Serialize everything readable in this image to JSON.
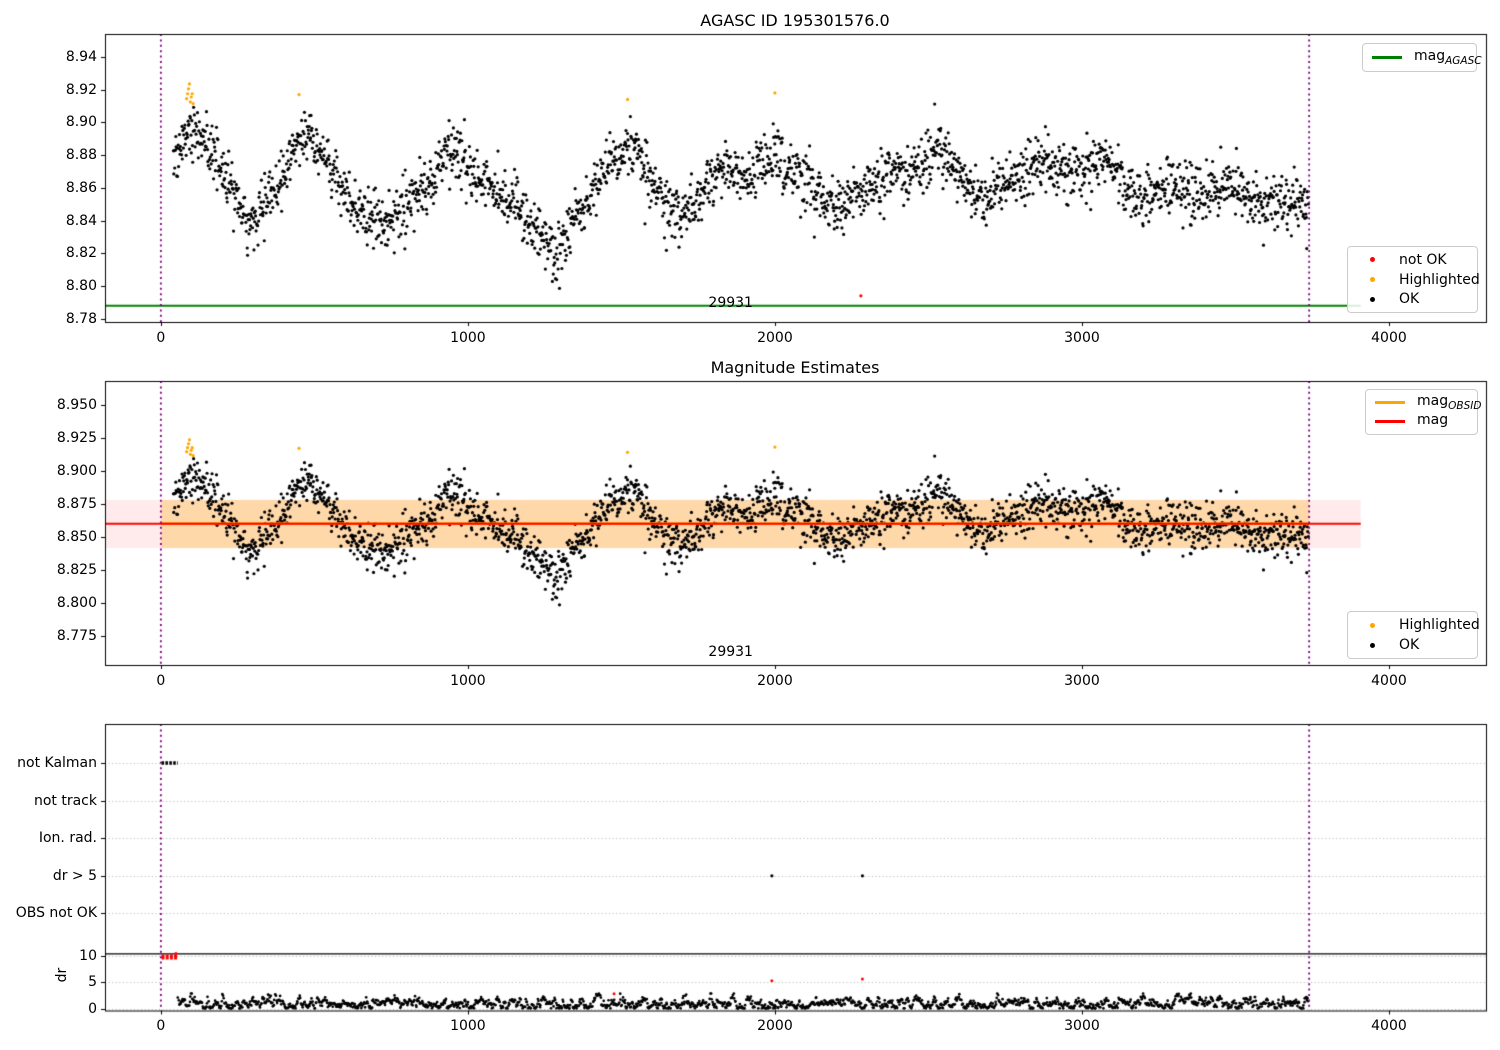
{
  "colors": {
    "ok": "#000000",
    "not_ok": "#ff0000",
    "highlighted": "#ffa500",
    "mag_agasc_line": "#008000",
    "mag_line": "#ff0000",
    "obsid_line": "#ffa500",
    "vline": "#800080",
    "band_pink": "rgba(255,0,0,0.08)",
    "band_orange": "rgba(255,165,0,0.28)",
    "grid": "#b4b4b4",
    "separator": "#000000"
  },
  "chart_data": [
    {
      "type": "scatter",
      "title": "AGASC ID 195301576.0",
      "xlim": [
        -182,
        4316
      ],
      "ylim": [
        8.778,
        8.954
      ],
      "grid": false,
      "xticks": [
        {
          "v": 0,
          "label": "0"
        },
        {
          "v": 1000,
          "label": "1000"
        },
        {
          "v": 2000,
          "label": "2000"
        },
        {
          "v": 3000,
          "label": "3000"
        },
        {
          "v": 4000,
          "label": "4000"
        }
      ],
      "yticks": [
        {
          "v": 8.78,
          "label": "8.78"
        },
        {
          "v": 8.8,
          "label": "8.80"
        },
        {
          "v": 8.82,
          "label": "8.82"
        },
        {
          "v": 8.84,
          "label": "8.84"
        },
        {
          "v": 8.86,
          "label": "8.86"
        },
        {
          "v": 8.88,
          "label": "8.88"
        },
        {
          "v": 8.9,
          "label": "8.90"
        },
        {
          "v": 8.92,
          "label": "8.92"
        },
        {
          "v": 8.94,
          "label": "8.94"
        }
      ],
      "hline": {
        "y": 8.788,
        "x0": -182,
        "x1": 3908
      },
      "vlines": [
        0,
        3740
      ],
      "annotation": {
        "text": "29931",
        "x": 1856,
        "y": 8.7865
      },
      "legend_line": {
        "label_main": "mag",
        "label_sub": "AGASC",
        "position": "upper right"
      },
      "legend_markers": {
        "position": "lower right",
        "entries": [
          {
            "label": "not OK",
            "color_key": "not_ok"
          },
          {
            "label": "Highlighted",
            "color_key": "highlighted"
          },
          {
            "label": "OK",
            "color_key": "ok"
          }
        ]
      },
      "scatter_model": {
        "n": 2400,
        "x_start": 40,
        "x_end": 3738,
        "sigma": 0.0082,
        "seed": 42,
        "dip_prob": 0.05,
        "dip_max": 0.018,
        "mean_x": [
          40,
          70,
          100,
          130,
          170,
          210,
          250,
          290,
          330,
          370,
          410,
          450,
          480,
          520,
          560,
          610,
          660,
          720,
          780,
          840,
          900,
          950,
          990,
          1040,
          1090,
          1140,
          1190,
          1240,
          1290,
          1340,
          1390,
          1440,
          1490,
          1540,
          1590,
          1640,
          1690,
          1740,
          1790,
          1840,
          1890,
          1940,
          1990,
          2040,
          2090,
          2140,
          2190,
          2240,
          2290,
          2340,
          2390,
          2440,
          2490,
          2540,
          2590,
          2640,
          2690,
          2740,
          2790,
          2840,
          2890,
          2940,
          2990,
          3040,
          3090,
          3140,
          3190,
          3240,
          3290,
          3340,
          3390,
          3440,
          3490,
          3540,
          3590,
          3640,
          3690,
          3738
        ],
        "mean_y": [
          8.876,
          8.888,
          8.898,
          8.891,
          8.882,
          8.866,
          8.848,
          8.84,
          8.85,
          8.862,
          8.876,
          8.888,
          8.894,
          8.883,
          8.87,
          8.852,
          8.844,
          8.838,
          8.846,
          8.856,
          8.872,
          8.886,
          8.877,
          8.866,
          8.86,
          8.853,
          8.842,
          8.828,
          8.822,
          8.836,
          8.854,
          8.868,
          8.88,
          8.886,
          8.868,
          8.852,
          8.843,
          8.85,
          8.864,
          8.876,
          8.868,
          8.872,
          8.88,
          8.87,
          8.867,
          8.857,
          8.848,
          8.853,
          8.861,
          8.866,
          8.867,
          8.87,
          8.877,
          8.884,
          8.872,
          8.86,
          8.854,
          8.861,
          8.867,
          8.872,
          8.877,
          8.869,
          8.871,
          8.877,
          8.878,
          8.862,
          8.853,
          8.857,
          8.863,
          8.859,
          8.854,
          8.86,
          8.862,
          8.855,
          8.85,
          8.852,
          8.853,
          8.849
        ]
      },
      "highlighted_points": [
        [
          84,
          8.9145
        ],
        [
          87,
          8.9175
        ],
        [
          90,
          8.9205
        ],
        [
          93,
          8.9235
        ],
        [
          96,
          8.9125
        ],
        [
          99,
          8.9155
        ],
        [
          102,
          8.9175
        ],
        [
          105,
          8.9115
        ],
        [
          450,
          8.917
        ],
        [
          1520,
          8.914
        ],
        [
          2000,
          8.918
        ]
      ],
      "not_ok_points": [
        [
          2280,
          8.794
        ]
      ]
    },
    {
      "type": "scatter",
      "title": "Magnitude Estimates",
      "xlim": [
        -182,
        4316
      ],
      "ylim": [
        8.753,
        8.968
      ],
      "grid": false,
      "xticks": [
        {
          "v": 0,
          "label": "0"
        },
        {
          "v": 1000,
          "label": "1000"
        },
        {
          "v": 2000,
          "label": "2000"
        },
        {
          "v": 3000,
          "label": "3000"
        },
        {
          "v": 4000,
          "label": "4000"
        }
      ],
      "yticks": [
        {
          "v": 8.775,
          "label": "8.775"
        },
        {
          "v": 8.8,
          "label": "8.800"
        },
        {
          "v": 8.825,
          "label": "8.825"
        },
        {
          "v": 8.85,
          "label": "8.850"
        },
        {
          "v": 8.875,
          "label": "8.875"
        },
        {
          "v": 8.9,
          "label": "8.900"
        },
        {
          "v": 8.925,
          "label": "8.925"
        },
        {
          "v": 8.95,
          "label": "8.950"
        }
      ],
      "band": {
        "y0": 8.8415,
        "y1": 8.878,
        "x0": -182,
        "x1": 3908,
        "color_key": "band_pink"
      },
      "band_obsid": {
        "y0": 8.8415,
        "y1": 8.878,
        "x0": 0,
        "x1": 3740,
        "color_key": "band_orange"
      },
      "mag_line": {
        "y": 8.86,
        "x0": -182,
        "x1": 3908
      },
      "obsid_line": {
        "y": 8.86,
        "x0": 0,
        "x1": 3740
      },
      "vlines": [
        0,
        3740
      ],
      "annotation": {
        "text": "29931",
        "x": 1856,
        "y": 8.759
      },
      "legend_lines": {
        "position": "upper right",
        "entries": [
          {
            "label_main": "mag",
            "label_sub": "OBSID",
            "color_key": "obsid_line"
          },
          {
            "label_main": "mag",
            "label_sub": "",
            "color_key": "mag_line"
          }
        ]
      },
      "legend_markers": {
        "position": "lower right",
        "entries": [
          {
            "label": "Highlighted",
            "color_key": "highlighted"
          },
          {
            "label": "OK",
            "color_key": "ok"
          }
        ]
      },
      "uses_scatter_of": 0,
      "highlighted_points": [
        [
          84,
          8.9145
        ],
        [
          87,
          8.9175
        ],
        [
          90,
          8.9205
        ],
        [
          93,
          8.9235
        ],
        [
          96,
          8.9125
        ],
        [
          99,
          8.9155
        ],
        [
          102,
          8.9175
        ],
        [
          105,
          8.9115
        ],
        [
          450,
          8.917
        ],
        [
          1520,
          8.914
        ],
        [
          2000,
          8.918
        ]
      ]
    },
    {
      "type": "flags",
      "rows": [
        {
          "label": "not Kalman"
        },
        {
          "label": "not track"
        },
        {
          "label": "Ion. rad."
        },
        {
          "label": "dr > 5"
        },
        {
          "label": "OBS not OK"
        }
      ],
      "dr_axis": {
        "label": "dr",
        "ticks": [
          {
            "v": 10,
            "label": "10"
          },
          {
            "v": 5,
            "label": "5"
          },
          {
            "v": 0,
            "label": "0"
          }
        ],
        "separator_dr": 10.3
      },
      "xlim": [
        -182,
        4316
      ],
      "xticks": [
        {
          "v": 0,
          "label": "0"
        },
        {
          "v": 1000,
          "label": "1000"
        },
        {
          "v": 2000,
          "label": "2000"
        },
        {
          "v": 3000,
          "label": "3000"
        },
        {
          "v": 4000,
          "label": "4000"
        }
      ],
      "grid": true,
      "vlines": [
        0,
        3740
      ],
      "flag_segments": [
        {
          "row": "not Kalman",
          "x0": 2,
          "x1": 55
        }
      ],
      "dr_clipped_segment": {
        "x0": 2,
        "x1": 55,
        "dr": 9.7
      },
      "flag_points": [
        {
          "row": "dr > 5",
          "x": 1990
        },
        {
          "row": "dr > 5",
          "x": 2285
        }
      ],
      "dr_red_points": [
        [
          1476,
          2.85
        ],
        [
          1990,
          5.3
        ],
        [
          2285,
          5.6
        ]
      ],
      "dr_model": {
        "n": 1750,
        "x_start": 55,
        "x_end": 3738,
        "mean": 1.0,
        "amp": 0.85,
        "min": 0.12,
        "max": 2.9,
        "seed": 7
      }
    }
  ]
}
